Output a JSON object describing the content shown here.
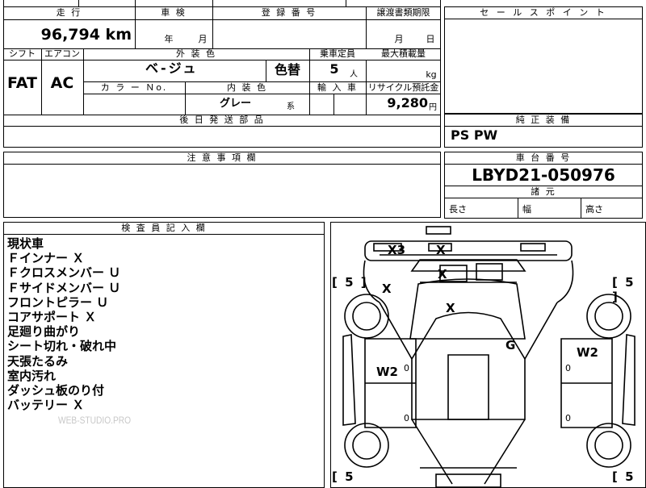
{
  "main_table": {
    "top_strip": "",
    "mileage_header": "走 行",
    "mileage_value": "96,794 km",
    "inspection_header": "車 検",
    "inspection_year": "年",
    "inspection_month": "月",
    "registration_header": "登 録 番 号",
    "transfer_header": "譲渡書類期限",
    "transfer_month": "月",
    "transfer_day": "日",
    "shift_header": "シフト",
    "ac_header": "エアコン",
    "shift_value": "FAT",
    "ac_value": "AC",
    "exterior_color_header": "外 装 色",
    "exterior_color_value": "ベ-ジュ",
    "color_change": "色替",
    "capacity_header": "乗車定員",
    "capacity_value": "5",
    "capacity_unit": "人",
    "max_load_header": "最大積載量",
    "max_load_unit": "kg",
    "color_no_header": "カ ラ ー Ｎo.",
    "interior_color_header": "内 装 色",
    "interior_color_value": "グレー",
    "interior_color_suffix": "系",
    "import_header": "輸 入 車",
    "recycle_header": "リサイクル預託金",
    "recycle_value": "9,280",
    "recycle_unit": "円",
    "later_parts_header": "後 日 発 送 部 品"
  },
  "sales_point": {
    "header": "セ ー ル ス ポ イ ン ト"
  },
  "equipment": {
    "header": "純 正 装 備",
    "value": "PS PW"
  },
  "notice": {
    "header": "注 意 事 項 欄"
  },
  "chassis": {
    "header": "車 台 番 号",
    "value": "LBYD21-050976",
    "dimensions_header": "諸 元",
    "length_label": "長さ",
    "width_label": "幅",
    "height_label": "高さ"
  },
  "inspector": {
    "header": "検 査 員 記 入 欄",
    "notes": [
      "現状車",
      "Ｆインナー Ｘ",
      "Ｆクロスメンバー Ｕ",
      "Ｆサイドメンバー Ｕ",
      "フロントピラー Ｕ",
      "コアサポート Ｘ",
      "足廻り曲がり",
      "シート切れ・破れ中",
      "天張たるみ",
      "室内汚れ",
      "ダッシュ板のり付",
      "バッテリー Ｘ"
    ],
    "watermark": "WEB-STUDIO.PRO"
  },
  "diagram": {
    "marks": {
      "front_bumper": "X3",
      "bonnet_top": "X",
      "bonnet_inner": "X",
      "left_front_fender": "X",
      "roof_front": "X",
      "roof_center": "G",
      "left_door": "W2",
      "right_door": "W2"
    },
    "tire_depth_top_left": "[ 5 ]",
    "tire_depth_top_right": "[ 5 ]",
    "tire_depth_bottom_left": "[ 5",
    "tire_depth_bottom_right": "[ 5",
    "small_mark": "0"
  }
}
